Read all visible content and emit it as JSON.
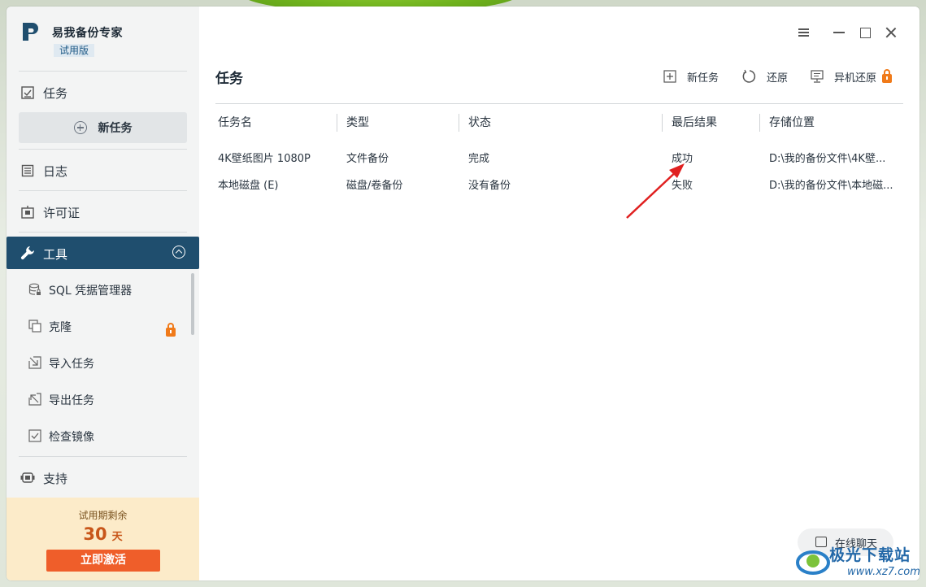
{
  "app": {
    "name": "易我备份专家",
    "edition_tag": "试用版"
  },
  "sidebar": {
    "tasks_label": "任务",
    "new_task_label": "新任务",
    "log_label": "日志",
    "license_label": "许可证",
    "tools_label": "工具",
    "tools_items": [
      {
        "label": "SQL 凭据管理器",
        "icon": "database-icon",
        "locked": false
      },
      {
        "label": "克隆",
        "icon": "clone-icon",
        "locked": true
      },
      {
        "label": "导入任务",
        "icon": "import-icon",
        "locked": false
      },
      {
        "label": "导出任务",
        "icon": "export-icon",
        "locked": false
      },
      {
        "label": "检查镜像",
        "icon": "check-image-icon",
        "locked": false
      }
    ],
    "support_label": "支持",
    "trial": {
      "remain_label": "试用期剩余",
      "days": "30",
      "days_unit": "天",
      "activate_label": "立即激活"
    }
  },
  "main": {
    "title": "任务",
    "actions": {
      "new_task": "新任务",
      "restore": "还原",
      "remote_restore": "异机还原"
    },
    "table": {
      "columns": [
        "任务名",
        "类型",
        "状态",
        "最后结果",
        "存储位置"
      ],
      "rows": [
        {
          "name": "4K壁纸图片 1080P",
          "type": "文件备份",
          "status": "完成",
          "result": "成功",
          "location": "D:\\我的备份文件\\4K壁..."
        },
        {
          "name": "本地磁盘 (E)",
          "type": "磁盘/卷备份",
          "status": "没有备份",
          "result": "失败",
          "location": "D:\\我的备份文件\\本地磁..."
        }
      ]
    },
    "chat_label": "在线聊天"
  },
  "watermark": {
    "text": "极光下载站",
    "url": "www.xz7.com"
  },
  "colors": {
    "accent": "#1f4e6e",
    "lock": "#f07a19",
    "activate": "#ef5e2a",
    "trial_bg": "#fcebc9",
    "arrow": "#e02020"
  }
}
